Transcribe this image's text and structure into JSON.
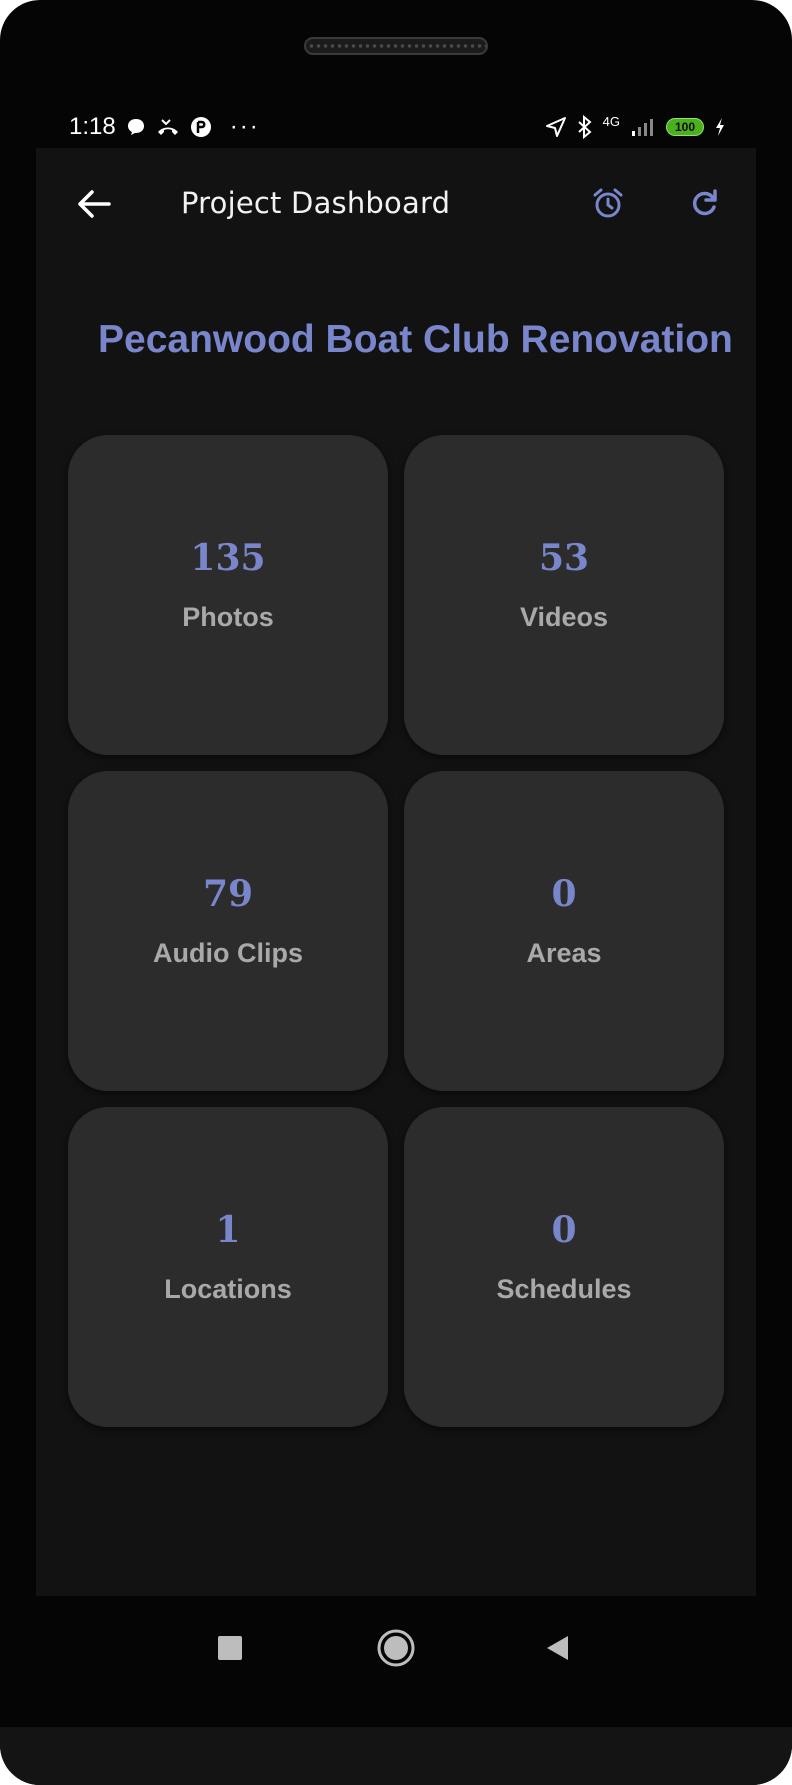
{
  "status_bar": {
    "time": "1:18",
    "network": "4G",
    "battery": "100"
  },
  "app_bar": {
    "title": "Project Dashboard"
  },
  "project": {
    "name": "Pecanwood Boat Club Renovation"
  },
  "stats": [
    {
      "value": "135",
      "label": "Photos"
    },
    {
      "value": "53",
      "label": "Videos"
    },
    {
      "value": "79",
      "label": "Audio Clips"
    },
    {
      "value": "0",
      "label": "Areas"
    },
    {
      "value": "1",
      "label": "Locations"
    },
    {
      "value": "0",
      "label": "Schedules"
    }
  ],
  "colors": {
    "accent": "#7986cb",
    "screen_background": "#121212",
    "card_background": "#2c2c2c",
    "label_text": "#a9a9a9"
  },
  "icons": [
    "arrow-left-icon",
    "alarm-clock-icon",
    "refresh-icon",
    "nav-recents-icon",
    "nav-home-icon",
    "nav-back-icon"
  ]
}
